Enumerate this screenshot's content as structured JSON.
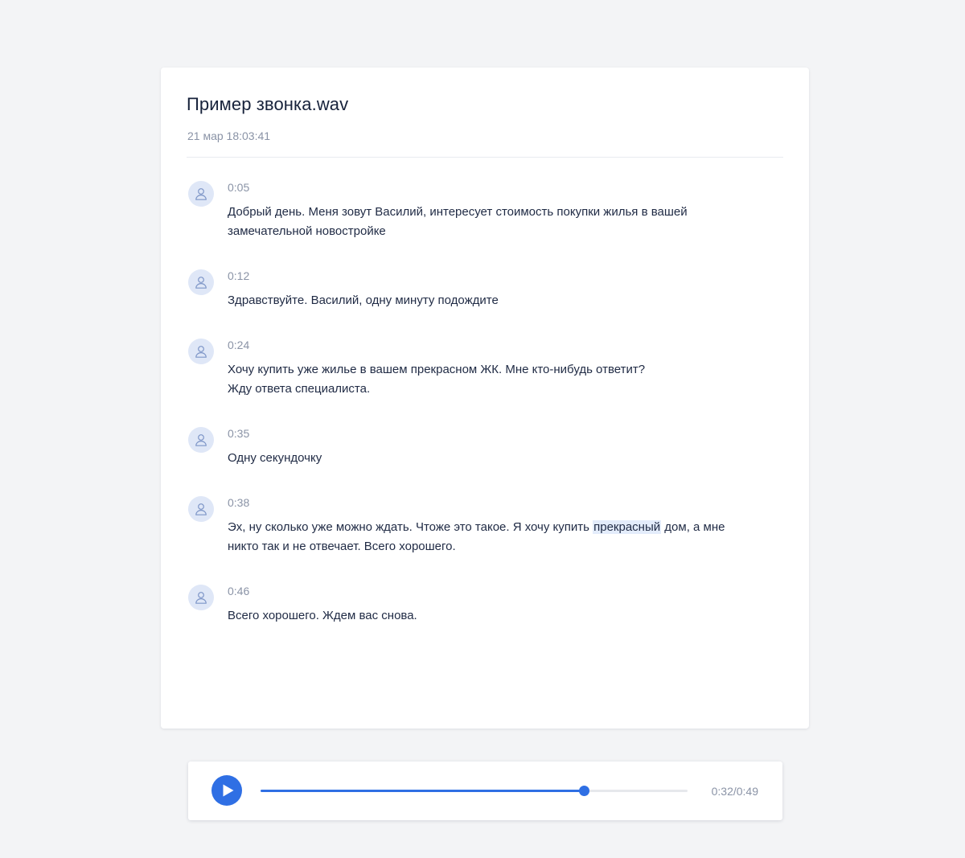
{
  "card": {
    "title": "Пример звонка.wav",
    "subtitle": "21 мар 18:03:41"
  },
  "messages": [
    {
      "time": "0:05",
      "text": "Добрый день. Меня зовут Василий, интересует стоимость покупки жилья в вашей\nзамечательной новостройке",
      "avatar_icon": "user-icon"
    },
    {
      "time": "0:12",
      "text": "Здравствуйте. Василий, одну минуту подождите",
      "avatar_icon": "user-icon"
    },
    {
      "time": "0:24",
      "text": "Хочу купить уже жилье в вашем прекрасном ЖК. Мне кто-нибудь ответит?\nЖду ответа специалиста.",
      "avatar_icon": "user-icon"
    },
    {
      "time": "0:35",
      "text": "Одну секундочку",
      "avatar_icon": "user-icon"
    },
    {
      "time": "0:38",
      "text_before": "Эх, ну сколько уже можно ждать. Чтоже это такое. Я хочу купить ",
      "highlight": "прекрасный",
      "text_after": " дом, а мне\nникто так и не отвечает. Всего хорошего.",
      "avatar_icon": "user-icon"
    },
    {
      "time": "0:46",
      "text": "Всего хорошего. Ждем вас снова.",
      "avatar_icon": "user-icon"
    }
  ],
  "player": {
    "play_icon": "play-icon",
    "time_readout": "0:32/0:49",
    "progress_fraction": 0.758,
    "accent_color": "#2f6fe4",
    "track_color": "#e6e8ec"
  },
  "colors": {
    "background": "#f3f4f6",
    "avatar_bg": "#dfe7f7",
    "highlight_bg": "#e3ecfb"
  }
}
